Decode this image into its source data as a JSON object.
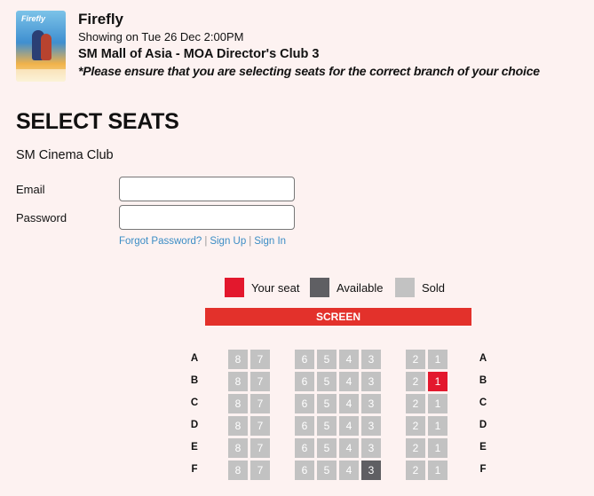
{
  "movie": {
    "poster_text": "Firefly",
    "title": "Firefly",
    "showing": "Showing on Tue 26 Dec 2:00PM",
    "venue": "SM Mall of Asia - MOA Director's Club 3",
    "warning": "*Please ensure that you are selecting seats for the correct branch of your choice"
  },
  "page": {
    "heading": "SELECT SEATS",
    "club": "SM Cinema Club"
  },
  "login": {
    "email_label": "Email",
    "email_value": "",
    "password_label": "Password",
    "password_value": "",
    "forgot": "Forgot Password?",
    "separator": "|",
    "signup": "Sign Up",
    "signin": "Sign In"
  },
  "legend": {
    "your_seat": "Your seat",
    "available": "Available",
    "sold": "Sold"
  },
  "screen_label": "SCREEN",
  "colors": {
    "your_seat": "#e3182d",
    "available": "#5f5f63",
    "sold": "#c2c2c2"
  },
  "seat_map": {
    "rows": [
      {
        "label": "A",
        "seats": {
          "8": "sold",
          "7": "sold",
          "6": "sold",
          "5": "sold",
          "4": "sold",
          "3": "sold",
          "2": "sold",
          "1": "sold"
        }
      },
      {
        "label": "B",
        "seats": {
          "8": "sold",
          "7": "sold",
          "6": "sold",
          "5": "sold",
          "4": "sold",
          "3": "sold",
          "2": "sold",
          "1": "your_seat"
        }
      },
      {
        "label": "C",
        "seats": {
          "8": "sold",
          "7": "sold",
          "6": "sold",
          "5": "sold",
          "4": "sold",
          "3": "sold",
          "2": "sold",
          "1": "sold"
        }
      },
      {
        "label": "D",
        "seats": {
          "8": "sold",
          "7": "sold",
          "6": "sold",
          "5": "sold",
          "4": "sold",
          "3": "sold",
          "2": "sold",
          "1": "sold"
        }
      },
      {
        "label": "E",
        "seats": {
          "8": "sold",
          "7": "sold",
          "6": "sold",
          "5": "sold",
          "4": "sold",
          "3": "sold",
          "2": "sold",
          "1": "sold"
        }
      },
      {
        "label": "F",
        "seats": {
          "8": "sold",
          "7": "sold",
          "6": "sold",
          "5": "sold",
          "4": "sold",
          "3": "available",
          "2": "sold",
          "1": "sold"
        }
      }
    ]
  }
}
